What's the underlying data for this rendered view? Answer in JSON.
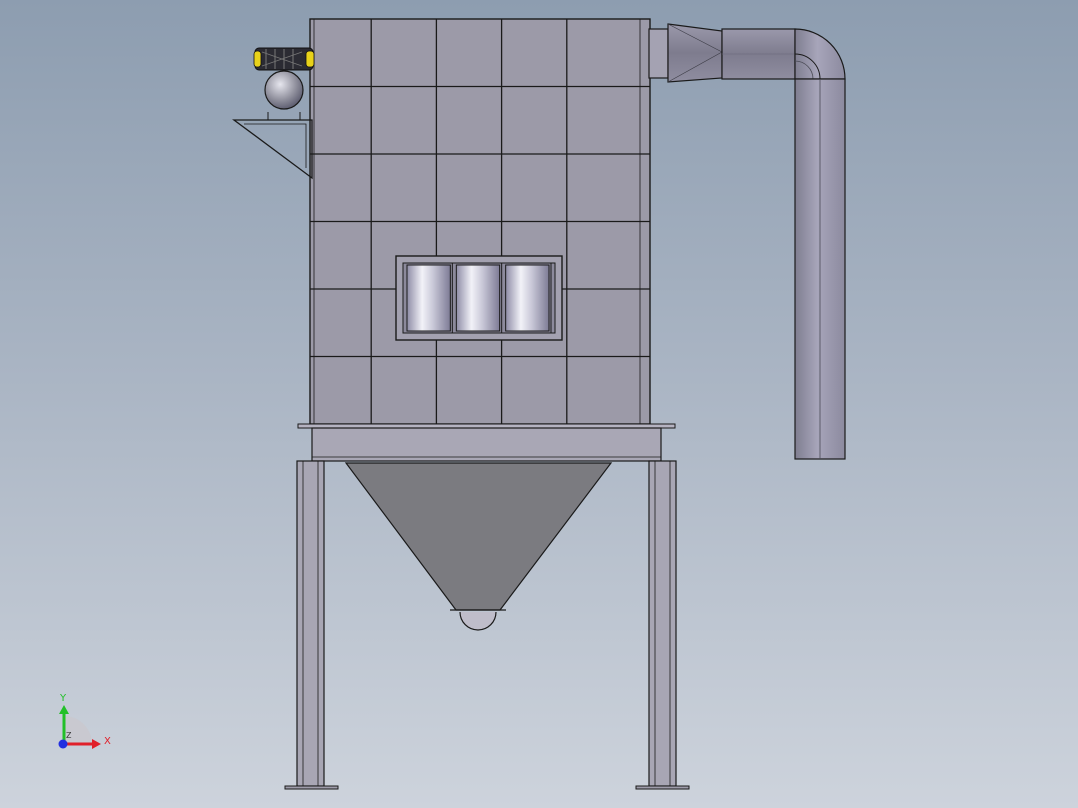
{
  "model_view": {
    "model": "dust-collector-assembly",
    "view": "front",
    "background": {
      "top_color": "#8d9db0",
      "bottom_color": "#cdd3dc"
    },
    "body": {
      "panel_columns": 5,
      "panel_rows": 6,
      "panel_color": "#9c9aa8",
      "inspection_window_tubes": 3
    },
    "hopper_color": "#7b7b80",
    "duct_color": "#8d8b9c",
    "motor_accent_color": "#e8d21a",
    "triad": {
      "x_label": "X",
      "y_label": "Y",
      "z_label": "Z",
      "x_color": "#e0202a",
      "y_color": "#22c028",
      "z_color": "#2230e0"
    }
  }
}
